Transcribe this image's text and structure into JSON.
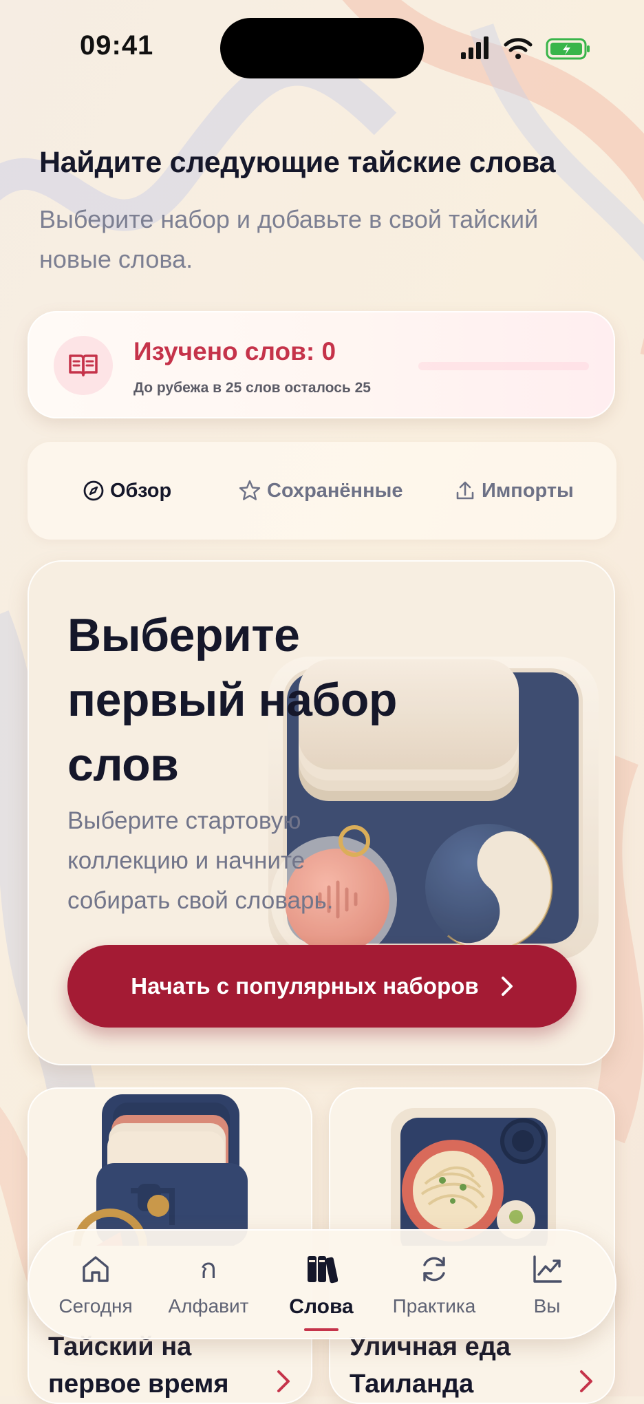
{
  "status_bar": {
    "time": "09:41"
  },
  "header": {
    "title": "Найдите следующие тайские слова",
    "subtitle": "Выберите набор и добавьте в свой тайский новые слова."
  },
  "progress": {
    "title": "Изучено слов: 0",
    "subtitle": "До рубежа в 25 слов осталось 25",
    "learned": 0,
    "milestone": 25,
    "icon": "book-icon"
  },
  "tabs": [
    {
      "label": "Обзор",
      "icon": "compass-icon",
      "active": true
    },
    {
      "label": "Сохранённые",
      "icon": "star-icon",
      "active": false
    },
    {
      "label": "Импорты",
      "icon": "upload-icon",
      "active": false
    }
  ],
  "hero": {
    "title": "Выберите первый набор слов",
    "description": "Выберите стартовую коллекцию и начните собирать свой словарь.",
    "button_label": "Начать с популярных наборов"
  },
  "collections": [
    {
      "title": "Тайский на первое время"
    },
    {
      "title": "Уличная еда Таиланда"
    }
  ],
  "nav": [
    {
      "label": "Сегодня",
      "icon": "home-icon",
      "active": false
    },
    {
      "label": "Алфавит",
      "icon": "thai-letter-icon",
      "glyph": "ก",
      "active": false
    },
    {
      "label": "Слова",
      "icon": "books-icon",
      "active": true
    },
    {
      "label": "Практика",
      "icon": "refresh-icon",
      "active": false
    },
    {
      "label": "Вы",
      "icon": "chart-icon",
      "active": false
    }
  ],
  "colors": {
    "accent": "#c5334a",
    "button": "#a41b34",
    "text": "#15172a",
    "muted": "#72758a"
  }
}
